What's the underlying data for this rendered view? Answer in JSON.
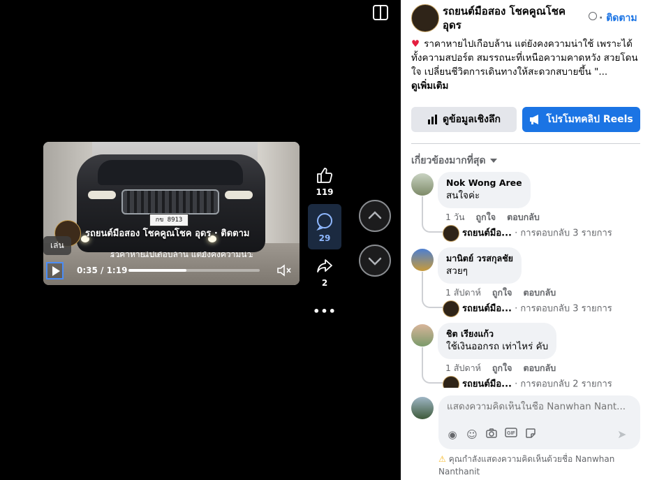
{
  "viewer": {
    "video_title": "รถยนต์มือสอง โชคคูณโชค อุดร · ติดตาม",
    "play_tooltip": "เล่น",
    "time_display": "0:35 / 1:19",
    "progress": 0.44,
    "plate": "กข 8913",
    "likes": "119",
    "comments": "29",
    "shares": "2",
    "more_icon": "•••"
  },
  "panel": {
    "page_name": "รถยนต์มือสอง โชคคูณโชค อุดร",
    "follow_label": "ติดตาม",
    "description": "ราคาหายไปเกือบล้าน แต่ยังคงความน่าใช้ เพราะได้ทั้งความสปอร์ต สมรรถนะที่เหนือความคาดหวัง สวยโดนใจ เปลี่ยนชีวิตการเดินทางให้สะดวกสบายขึ้น \"...",
    "see_more": "ดูเพิ่มเติม",
    "insights_label": "ดูข้อมูลเชิงลึก",
    "promote_label": "โปรโมทคลิป Reels",
    "sort_label": "เกี่ยวข้องมากที่สุด",
    "colors": {
      "accent": "#1b74e4",
      "heart": "#e41e3f"
    },
    "comments": [
      {
        "name": "Nok Wong Aree",
        "text": "สนใจค่ะ",
        "time": "1 วัน",
        "like": "ถูกใจ",
        "reply": "ตอบกลับ",
        "reply_page": "รถยนต์มือ...",
        "reply_count": "· การตอบกลับ 3 รายการ"
      },
      {
        "name": "มานิตย์ วรสกุลชัย",
        "text": "สวยๆ",
        "time": "1 สัปดาห์",
        "like": "ถูกใจ",
        "reply": "ตอบกลับ",
        "reply_page": "รถยนต์มือ...",
        "reply_count": "· การตอบกลับ 3 รายการ"
      },
      {
        "name": "ชิต เรียงแก้ว",
        "text": "ใช้เงินออกรถ เท่าไหร่ คับ",
        "time": "1 สัปดาห์",
        "like": "ถูกใจ",
        "reply": "ตอบกลับ",
        "reply_page": "รถยนต์มือ...",
        "reply_count": "· การตอบกลับ 2 รายการ"
      }
    ],
    "composer_placeholder": "แสดงความคิดเห็นในชื่อ Nanwhan Nant...",
    "composer_warning": "คุณกำลังแสดงความคิดเห็นด้วยชื่อ Nanwhan Nanthanit"
  }
}
